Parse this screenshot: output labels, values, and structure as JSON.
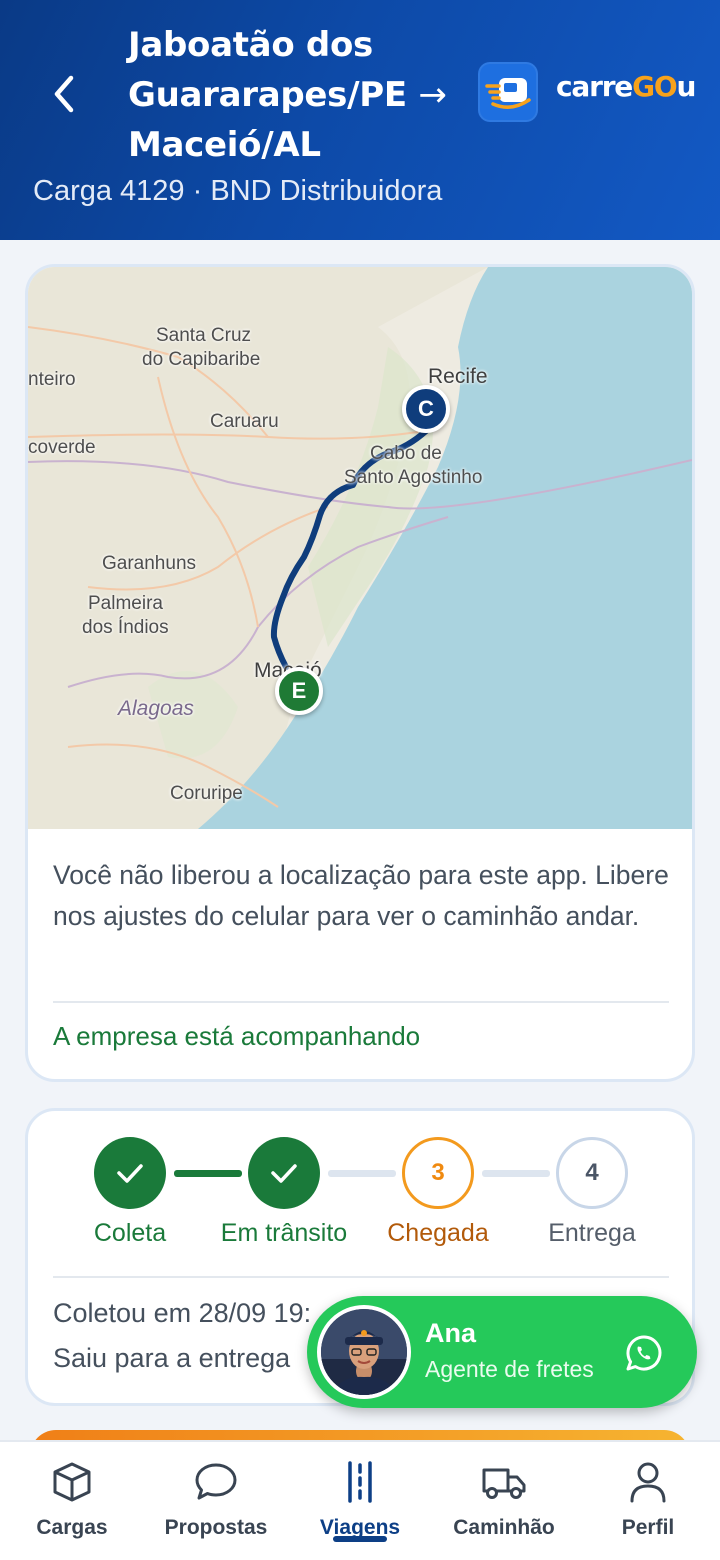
{
  "header": {
    "route_origin": "Jaboatão dos Guararapes/PE",
    "route_arrow": "→",
    "route_destination": "Maceió/AL",
    "subtitle": "Carga 4129 · BND Distribuidora",
    "logo": {
      "part1": "carre",
      "part2": "GO",
      "part3": "u"
    }
  },
  "map": {
    "labels": [
      "Santa Cruz",
      "do Capibaribe",
      "nteiro",
      "Caruaru",
      "coverde",
      "Recife",
      "Cabo de",
      "Santo Agostinho",
      "Garanhuns",
      "Palmeira",
      "dos Índios",
      "Maceió",
      "Alagoas",
      "Coruripe"
    ],
    "pin_origin": "C",
    "pin_destination": "E"
  },
  "location": {
    "message": "Você não liberou a localização para este app. Libere nos ajustes do celular para ver o caminhão andar.",
    "tracking": "A empresa está acompanhando"
  },
  "progress": {
    "steps": [
      {
        "label": "Coleta",
        "status": "done"
      },
      {
        "label": "Em trânsito",
        "status": "done"
      },
      {
        "label": "Chegada",
        "status": "current",
        "number": "3"
      },
      {
        "label": "Entrega",
        "status": "pending",
        "number": "4"
      }
    ],
    "line1": "Coletou em 28/09 19:",
    "line2": "Saiu para a entrega"
  },
  "agent": {
    "name": "Ana",
    "role": "Agente de fretes"
  },
  "nav": {
    "items": [
      {
        "label": "Cargas",
        "icon": "box-icon"
      },
      {
        "label": "Propostas",
        "icon": "chat-bubble-icon"
      },
      {
        "label": "Viagens",
        "icon": "road-icon",
        "active": true
      },
      {
        "label": "Caminhão",
        "icon": "truck-icon"
      },
      {
        "label": "Perfil",
        "icon": "user-icon"
      }
    ]
  },
  "colors": {
    "header": "#0d4aa8",
    "success": "#1a7a3a",
    "accent": "#f39a1e",
    "whatsapp": "#25c95a",
    "nav_active": "#0d3f86"
  }
}
